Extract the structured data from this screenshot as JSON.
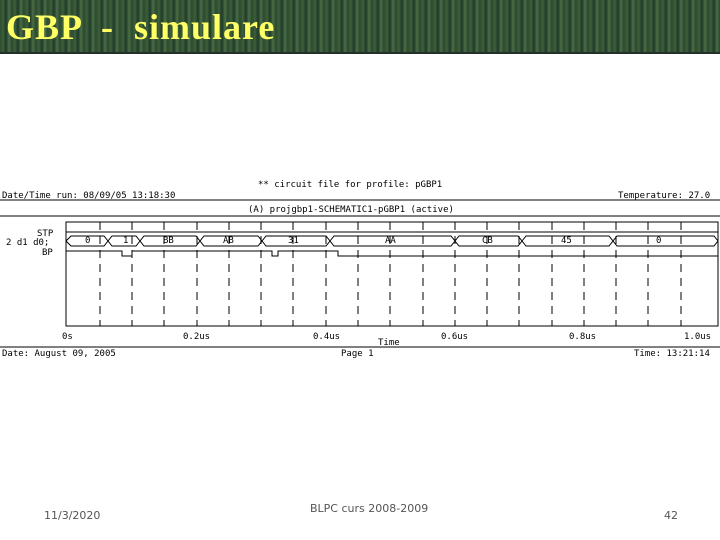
{
  "slide": {
    "title": "GBP  -  simulare",
    "footer_date": "11/3/2020",
    "footer_center": "BLPC curs 2008-2009",
    "page_number": "42"
  },
  "sim": {
    "header_circuit": "** circuit file for profile: pGBP1",
    "run_datetime": "Date/Time run: 08/09/05 13:18:30",
    "temperature": "Temperature: 27.0",
    "profile": "(A) projgbp1-SCHEMATIC1-pGBP1 (active)",
    "signals": [
      "STP",
      "2 d1 d0;",
      "BP"
    ],
    "bus_values": [
      "0",
      "1",
      "BB",
      "AB",
      "31",
      "AA",
      "CB",
      "45",
      "0"
    ],
    "time_ticks": [
      "0s",
      "0.2us",
      "0.4us",
      "0.6us",
      "0.8us",
      "1.0us"
    ],
    "xlabel": "Time",
    "footer_date": "Date: August 09, 2005",
    "footer_page": "Page 1",
    "footer_time": "Time: 13:21:14"
  }
}
